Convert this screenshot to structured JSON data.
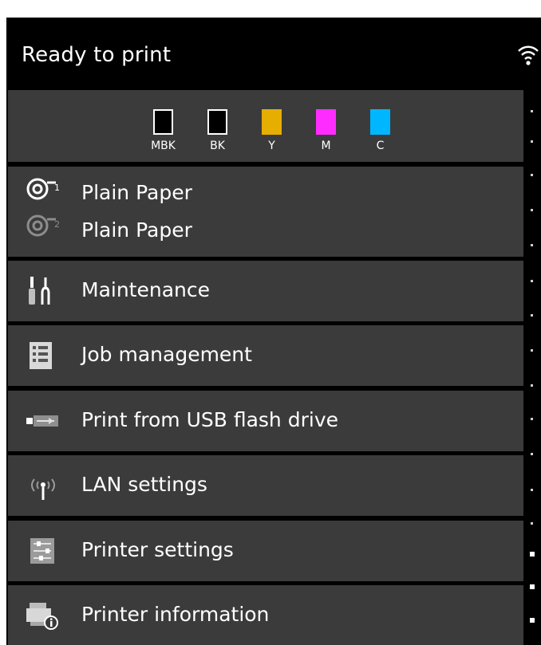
{
  "status": {
    "text": "Ready to print",
    "network_icon": "wifi-icon"
  },
  "ink": [
    {
      "label": "MBK",
      "color": "#000000"
    },
    {
      "label": "BK",
      "color": "#000000"
    },
    {
      "label": "Y",
      "color": "#e6ae00"
    },
    {
      "label": "M",
      "color": "#ff2cff"
    },
    {
      "label": "C",
      "color": "#00b7ff"
    }
  ],
  "paper": {
    "roll1_label": "Plain Paper",
    "roll2_label": "Plain Paper",
    "roll1_icon": "roll-1-icon",
    "roll2_icon": "roll-2-icon"
  },
  "menu": {
    "maintenance": "Maintenance",
    "job_management": "Job management",
    "print_usb": "Print from USB flash drive",
    "lan_settings": "LAN settings",
    "printer_settings": "Printer settings",
    "printer_information": "Printer information"
  }
}
